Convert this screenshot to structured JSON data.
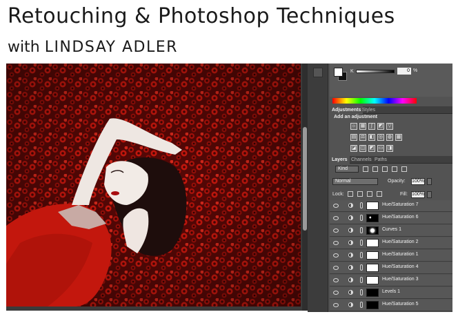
{
  "header": {
    "title": "Retouching & Photoshop Techniques",
    "subtitle_prefix": "with",
    "subtitle_name": "LINDSAY ADLER"
  },
  "color_panel": {
    "channel_label": "K",
    "value": "0",
    "unit": "%",
    "foreground": "#ffffff",
    "background": "#000000"
  },
  "adjustments_panel": {
    "tabs": [
      "Adjustments",
      "Styles"
    ],
    "active_tab": "Adjustments",
    "heading": "Add an adjustment"
  },
  "layers_panel": {
    "tabs": [
      "Layers",
      "Channels",
      "Paths"
    ],
    "active_tab": "Layers",
    "filter_kind": "Kind",
    "blend_mode": "Normal",
    "opacity_label": "Opacity:",
    "opacity_value": "100%",
    "lock_label": "Lock:",
    "fill_label": "Fill:",
    "fill_value": "100%",
    "layers": [
      {
        "name": "Hue/Saturation 7",
        "mask": "white"
      },
      {
        "name": "Hue/Saturation 6",
        "mask": "black-spots"
      },
      {
        "name": "Curves 1",
        "mask": "mixed"
      },
      {
        "name": "Hue/Saturation 2",
        "mask": "white"
      },
      {
        "name": "Hue/Saturation 1",
        "mask": "white"
      },
      {
        "name": "Hue/Saturation 4",
        "mask": "white"
      },
      {
        "name": "Hue/Saturation 3",
        "mask": "white"
      },
      {
        "name": "Levels 1",
        "mask": "black"
      },
      {
        "name": "Hue/Saturation 5",
        "mask": "black"
      }
    ]
  },
  "colors": {
    "photo_red": "#c0140c",
    "panel_gray": "#535353"
  }
}
